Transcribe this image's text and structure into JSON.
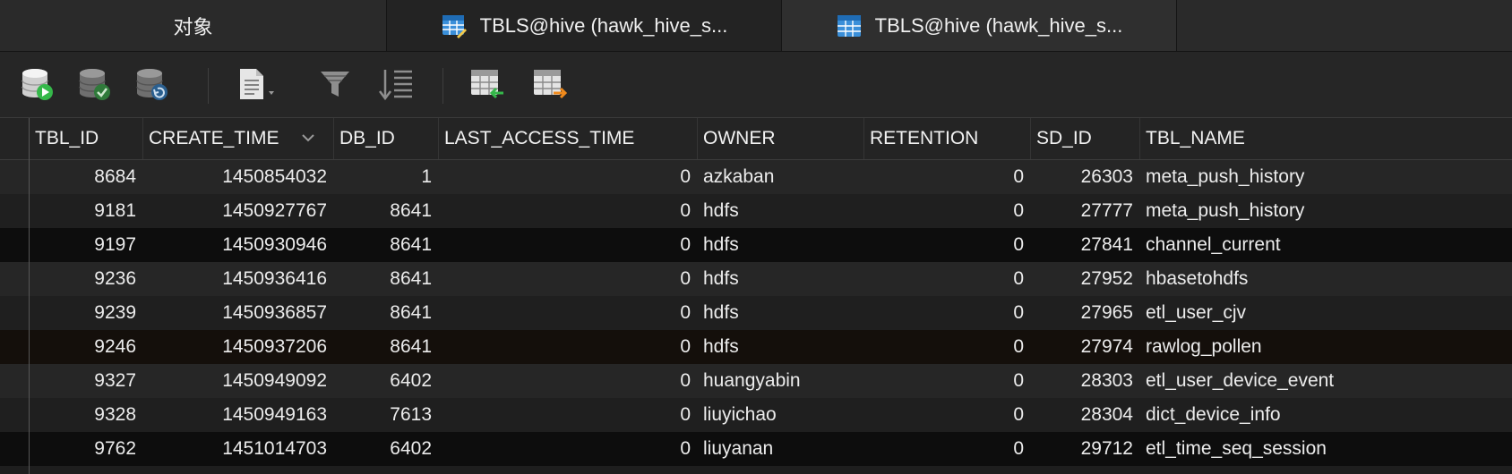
{
  "tabs": [
    {
      "label": "对象"
    },
    {
      "label": "TBLS@hive (hawk_hive_s..."
    },
    {
      "label": "TBLS@hive (hawk_hive_s..."
    }
  ],
  "toolbar": {
    "icons": [
      "database-run-icon",
      "database-commit-icon",
      "database-refresh-icon",
      "text-view-icon",
      "filter-icon",
      "sort-icon",
      "import-icon",
      "export-icon"
    ]
  },
  "colors": {
    "row_odd": "#262626",
    "row_even": "#1f1f1f",
    "row_dark": "#0d0d0d",
    "row_highlight": "#140f0b",
    "accent_green": "#35b84a",
    "accent_orange": "#f08a1c",
    "accent_blue": "#2f86d9"
  },
  "table": {
    "columns": [
      "TBL_ID",
      "CREATE_TIME",
      "DB_ID",
      "LAST_ACCESS_TIME",
      "OWNER",
      "RETENTION",
      "SD_ID",
      "TBL_NAME"
    ],
    "rows": [
      [
        "8684",
        "1450854032",
        "1",
        "0",
        "azkaban",
        "0",
        "26303",
        "meta_push_history"
      ],
      [
        "9181",
        "1450927767",
        "8641",
        "0",
        "hdfs",
        "0",
        "27777",
        "meta_push_history"
      ],
      [
        "9197",
        "1450930946",
        "8641",
        "0",
        "hdfs",
        "0",
        "27841",
        "channel_current"
      ],
      [
        "9236",
        "1450936416",
        "8641",
        "0",
        "hdfs",
        "0",
        "27952",
        "hbasetohdfs"
      ],
      [
        "9239",
        "1450936857",
        "8641",
        "0",
        "hdfs",
        "0",
        "27965",
        "etl_user_cjv"
      ],
      [
        "9246",
        "1450937206",
        "8641",
        "0",
        "hdfs",
        "0",
        "27974",
        "rawlog_pollen"
      ],
      [
        "9327",
        "1450949092",
        "6402",
        "0",
        "huangyabin",
        "0",
        "28303",
        "etl_user_device_event"
      ],
      [
        "9328",
        "1450949163",
        "7613",
        "0",
        "liuyichao",
        "0",
        "28304",
        "dict_device_info"
      ],
      [
        "9762",
        "1451014703",
        "6402",
        "0",
        "liuyanan",
        "0",
        "29712",
        "etl_time_seq_session"
      ]
    ]
  }
}
